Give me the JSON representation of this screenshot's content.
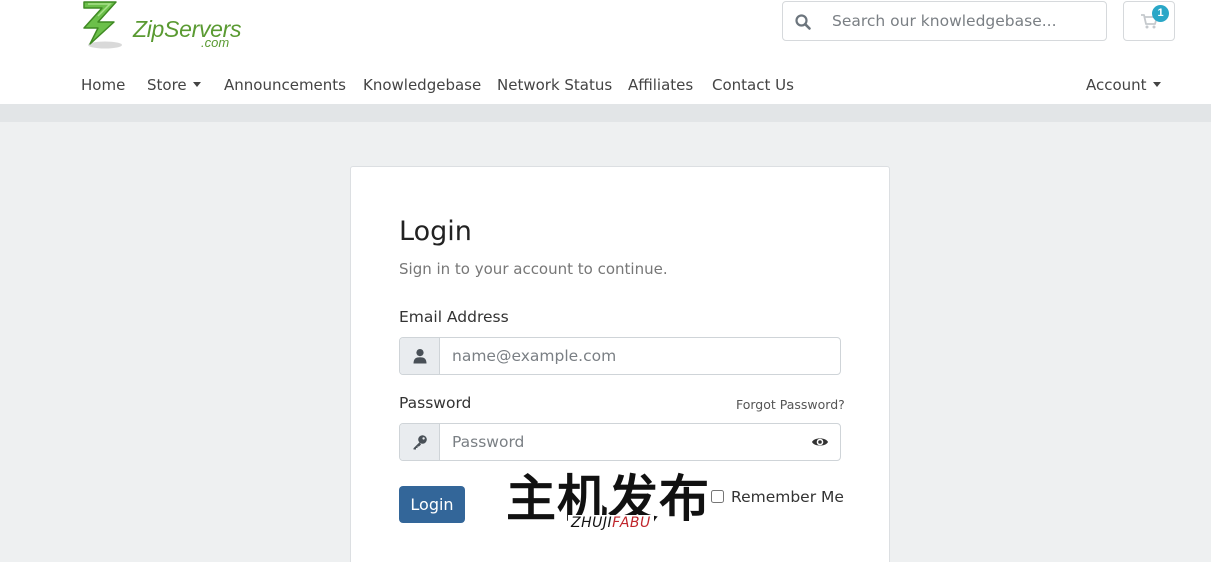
{
  "brand": {
    "name": "ZipServers",
    "suffix": ".com",
    "logo_icon": "lightning-bolt-icon",
    "accent_color": "#5a9a32"
  },
  "search": {
    "placeholder": "Search our knowledgebase...",
    "icon": "search-icon"
  },
  "cart": {
    "icon": "cart-icon",
    "count": "1",
    "badge_color": "#2aa7c7"
  },
  "nav": {
    "items": [
      {
        "label": "Home"
      },
      {
        "label": "Store",
        "dropdown": true
      },
      {
        "label": "Announcements"
      },
      {
        "label": "Knowledgebase"
      },
      {
        "label": "Network Status"
      },
      {
        "label": "Affiliates"
      },
      {
        "label": "Contact Us"
      }
    ],
    "account": {
      "label": "Account",
      "dropdown": true
    }
  },
  "login": {
    "title": "Login",
    "subtitle": "Sign in to your account to continue.",
    "email": {
      "label": "Email Address",
      "placeholder": "name@example.com",
      "icon": "user-icon"
    },
    "password": {
      "label": "Password",
      "placeholder": "Password",
      "icon": "key-icon",
      "toggle_icon": "eye-icon",
      "forgot_label": "Forgot Password?"
    },
    "submit_label": "Login",
    "remember_label": "Remember Me",
    "button_color": "#336699"
  },
  "watermark": {
    "text": "主机发布",
    "sub_black": "ZHUJI",
    "sub_red": "FABU"
  }
}
